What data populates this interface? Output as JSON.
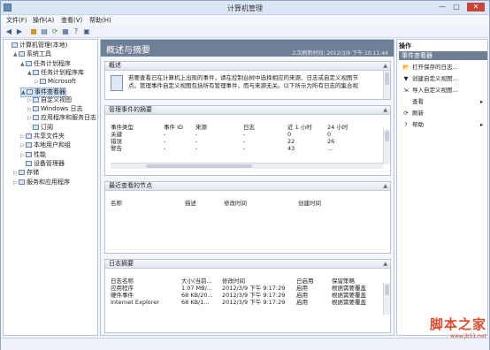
{
  "window": {
    "title": "计算机管理",
    "minimize": "—",
    "maximize": "□",
    "close": "✕"
  },
  "menu": [
    "文件(F)",
    "操作(A)",
    "查看(V)",
    "帮助(H)"
  ],
  "tree": [
    {
      "label": "计算机管理(本地)",
      "exp": "",
      "depth": 0
    },
    {
      "label": "系统工具",
      "exp": "▲",
      "depth": 1
    },
    {
      "label": "任务计划程序",
      "exp": "▲",
      "depth": 2
    },
    {
      "label": "任务计划程序库",
      "exp": "▲",
      "depth": 3
    },
    {
      "label": "Microsoft",
      "exp": "▷",
      "depth": 4
    },
    {
      "label": "事件查看器",
      "exp": "▲",
      "depth": 2,
      "selected": true
    },
    {
      "label": "自定义视图",
      "exp": "▷",
      "depth": 3
    },
    {
      "label": "Windows 日志",
      "exp": "▷",
      "depth": 3
    },
    {
      "label": "应用程序和服务日志",
      "exp": "▷",
      "depth": 3
    },
    {
      "label": "订阅",
      "exp": "",
      "depth": 3
    },
    {
      "label": "共享文件夹",
      "exp": "▷",
      "depth": 2
    },
    {
      "label": "本地用户和组",
      "exp": "▷",
      "depth": 2
    },
    {
      "label": "性能",
      "exp": "▷",
      "depth": 2
    },
    {
      "label": "设备管理器",
      "exp": "",
      "depth": 2
    },
    {
      "label": "存储",
      "exp": "▷",
      "depth": 1
    },
    {
      "label": "服务和应用程序",
      "exp": "▷",
      "depth": 1
    }
  ],
  "center": {
    "header": "概述与摘要",
    "timestamp": "上次刷新时间: 2012/3/9 下午 10:11:44",
    "overview": {
      "title": "概述",
      "text1": "若要查看已在计算机上出现的事件，请在控制台树中选择相应的来源、日志或自定义视图节",
      "text2": "点。管理事件自定义视图包括所有管理事件，而与来源无关。以下所示为所有日志的集合视"
    },
    "summary": {
      "title": "管理事件的摘要",
      "columns": [
        "事件类型",
        "事件 ID",
        "来源",
        "日志",
        "近 1 小时",
        "24 小时"
      ],
      "rows": [
        [
          "关键",
          "-",
          "-",
          "-",
          "0",
          "0"
        ],
        [
          "错误",
          "-",
          "-",
          "-",
          "22",
          "26"
        ],
        [
          "警告",
          "-",
          "-",
          "-",
          "43",
          "..."
        ]
      ]
    },
    "recent": {
      "title": "最近查看的节点",
      "columns": [
        "名称",
        "描述",
        "修改时间",
        "创建时间"
      ]
    },
    "logs": {
      "title": "日志摘要",
      "columns": [
        "日志名称",
        "大小(当前...",
        "修改时间",
        "已启用",
        "保留策略"
      ],
      "rows": [
        [
          "应用程序",
          "1.07 MB/...",
          "2012/3/9 下午 9:17:29",
          "启用",
          "根据需要覆盖"
        ],
        [
          "硬件事件",
          "68 KB/20...",
          "2012/3/9 下午 9:17:29",
          "启用",
          "根据需要覆盖"
        ],
        [
          "Internet Explorer",
          "68 KB/1...",
          "2012/3/9 下午 9:17:29",
          "启用",
          "根据需要覆盖"
        ]
      ]
    }
  },
  "actions": {
    "header": "操作",
    "selected": "事件查看器",
    "items": [
      {
        "label": "打开保存的日志...",
        "icon": "folder-icon",
        "glyph": "📂"
      },
      {
        "label": "创建自定义视图...",
        "icon": "filter-icon",
        "glyph": "▼"
      },
      {
        "label": "导入自定义视图...",
        "icon": "import-icon",
        "glyph": "⇲"
      },
      {
        "label": "查看",
        "icon": "view-icon",
        "glyph": "",
        "submenu": true
      },
      {
        "label": "刷新",
        "icon": "refresh-icon",
        "glyph": "⟳"
      },
      {
        "label": "帮助",
        "icon": "help-icon",
        "glyph": "?",
        "submenu": true
      }
    ]
  },
  "watermark": {
    "brand": "脚本之家",
    "url": "www.jb51.net"
  }
}
